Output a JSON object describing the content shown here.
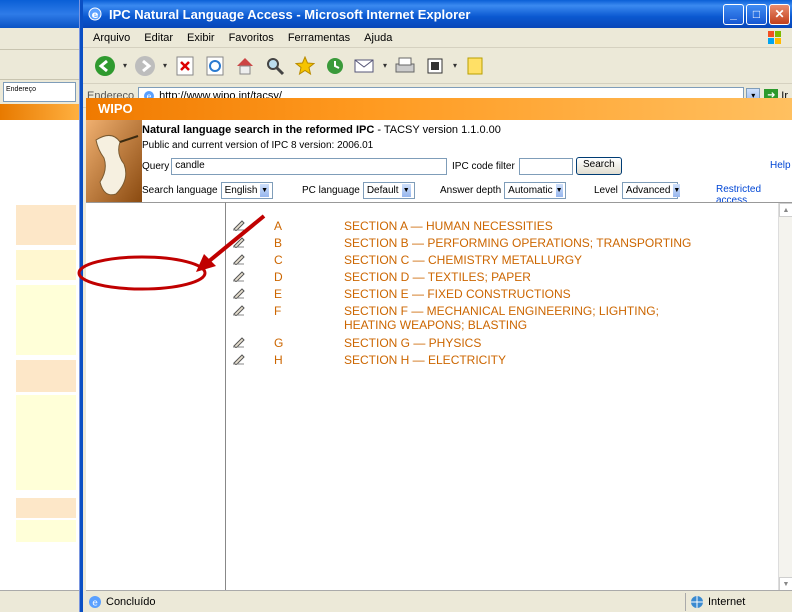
{
  "window": {
    "title": "IPC Natural Language Access - Microsoft Internet Explorer",
    "minimize": "_",
    "maximize": "□",
    "close": "✕"
  },
  "menu": [
    "Arquivo",
    "Editar",
    "Exibir",
    "Favoritos",
    "Ferramentas",
    "Ajuda"
  ],
  "address": {
    "label": "Endereço",
    "url": "http://www.wipo.int/tacsy/",
    "go_label": "Ir"
  },
  "page": {
    "org": "WIPO",
    "title_bold": "Natural language search in the reformed IPC",
    "title_rest": " - TACSY version 1.1.0.00",
    "subtitle": "Public and current version of IPC 8 version: 2006.01",
    "query_label": "Query",
    "query_value": "candle",
    "filter_label": "IPC code filter",
    "filter_value": "",
    "search_button": "Search",
    "help_link": "Help",
    "search_language_label": "Search language",
    "search_language_value": "English",
    "ipc_language_label": "PC language",
    "ipc_language_value": "Default",
    "answer_depth_label": "Answer depth",
    "answer_depth_value": "Automatic",
    "level_label": "Level",
    "level_value": "Advanced",
    "restricted_link": "Restricted access"
  },
  "sections": [
    {
      "code": "A",
      "title": "SECTION A — HUMAN NECESSITIES"
    },
    {
      "code": "B",
      "title": "SECTION B — PERFORMING OPERATIONS; TRANSPORTING"
    },
    {
      "code": "C",
      "title": "SECTION C — CHEMISTRY METALLURGY"
    },
    {
      "code": "D",
      "title": "SECTION D — TEXTILES; PAPER"
    },
    {
      "code": "E",
      "title": "SECTION E — FIXED CONSTRUCTIONS"
    },
    {
      "code": "F",
      "title": "SECTION F — MECHANICAL ENGINEERING; LIGHTING; HEATING WEAPONS; BLASTING"
    },
    {
      "code": "G",
      "title": "SECTION G — PHYSICS"
    },
    {
      "code": "H",
      "title": "SECTION H — ELECTRICITY"
    }
  ],
  "status": {
    "text": "Concluído",
    "zone": "Internet"
  },
  "background_window": {
    "title": "Endereço",
    "address": "Endereço",
    "status": "Ir"
  },
  "colors": {
    "section_link": "#cc6600",
    "wipo_bar": "#f07a00",
    "annotation": "#c00000"
  }
}
